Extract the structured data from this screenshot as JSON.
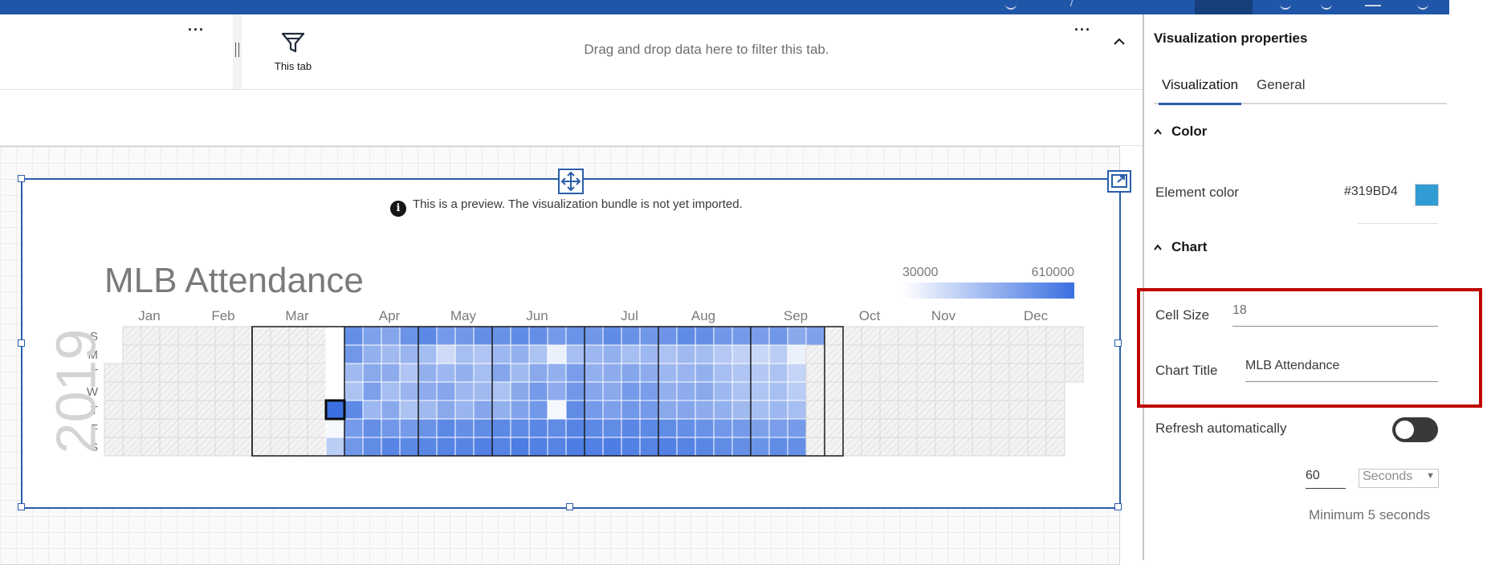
{
  "filter_bar": {
    "this_tab_label": "This tab",
    "drop_hint": "Drag and drop data here to filter this tab."
  },
  "visualization": {
    "preview_notice": "This is a preview. The visualization bundle is not yet imported.",
    "chart_title": "MLB Attendance",
    "year": "2019"
  },
  "chart_data": {
    "type": "heatmap",
    "title": "MLB Attendance",
    "year": "2019",
    "months": [
      "Jan",
      "Feb",
      "Mar",
      "Apr",
      "May",
      "Jun",
      "Jul",
      "Aug",
      "Sep",
      "Oct",
      "Nov",
      "Dec"
    ],
    "weekdays": [
      "S",
      "M",
      "T",
      "W",
      "T",
      "F",
      "S"
    ],
    "legend": {
      "min": 30000,
      "max": 610000,
      "min_label": "30000",
      "max_label": "610000"
    },
    "color_range": [
      "#ffffff",
      "#3a6fe0"
    ],
    "season_start_week": 12,
    "season_end_week": 39,
    "week_levels": [
      [],
      [],
      [],
      [],
      [],
      [],
      [],
      [],
      [],
      [],
      [],
      [],
      [
        0,
        0,
        0,
        0,
        0,
        0.05,
        0.35
      ],
      [
        0.78,
        0.72,
        0.48,
        0.42,
        0.82,
        0.7,
        0.72
      ],
      [
        0.65,
        0.55,
        0.6,
        0.66,
        0.5,
        0.78,
        0.8
      ],
      [
        0.62,
        0.48,
        0.58,
        0.45,
        0.6,
        0.72,
        0.85
      ],
      [
        0.75,
        0.52,
        0.4,
        0.52,
        0.42,
        0.7,
        0.82
      ],
      [
        0.82,
        0.46,
        0.55,
        0.58,
        0.48,
        0.76,
        0.84
      ],
      [
        0.7,
        0.25,
        0.5,
        0.62,
        0.6,
        0.82,
        0.86
      ],
      [
        0.72,
        0.45,
        0.55,
        0.5,
        0.52,
        0.78,
        0.85
      ],
      [
        0.78,
        0.4,
        0.45,
        0.48,
        0.62,
        0.8,
        0.88
      ],
      [
        0.76,
        0.5,
        0.62,
        0.42,
        0.55,
        0.82,
        0.86
      ],
      [
        0.8,
        0.55,
        0.48,
        0.6,
        0.64,
        0.8,
        0.9
      ],
      [
        0.78,
        0.42,
        0.6,
        0.7,
        0.72,
        0.84,
        0.88
      ],
      [
        0.7,
        0.1,
        0.55,
        0.58,
        0.05,
        0.8,
        0.86
      ],
      [
        0.75,
        0.45,
        0.68,
        0.72,
        0.8,
        0.86,
        0.9
      ],
      [
        0.72,
        0.5,
        0.55,
        0.62,
        0.7,
        0.82,
        0.88
      ],
      [
        0.8,
        0.55,
        0.58,
        0.6,
        0.66,
        0.8,
        0.9
      ],
      [
        0.76,
        0.45,
        0.62,
        0.7,
        0.72,
        0.84,
        0.88
      ],
      [
        0.72,
        0.5,
        0.58,
        0.68,
        0.7,
        0.82,
        0.86
      ],
      [
        0.74,
        0.42,
        0.5,
        0.55,
        0.6,
        0.8,
        0.88
      ],
      [
        0.8,
        0.48,
        0.52,
        0.58,
        0.62,
        0.78,
        0.86
      ],
      [
        0.78,
        0.46,
        0.55,
        0.6,
        0.58,
        0.76,
        0.84
      ],
      [
        0.72,
        0.38,
        0.45,
        0.5,
        0.55,
        0.72,
        0.8
      ],
      [
        0.7,
        0.32,
        0.4,
        0.42,
        0.48,
        0.7,
        0.78
      ],
      [
        0.68,
        0.28,
        0.38,
        0.4,
        0.45,
        0.66,
        0.75
      ],
      [
        0.72,
        0.35,
        0.42,
        0.44,
        0.5,
        0.68,
        0.8
      ],
      [
        0.6,
        0.1,
        0.3,
        0.35,
        0.45,
        0.7,
        0.78
      ],
      [
        0.65
      ]
    ],
    "highlighted_cell": {
      "week": 12,
      "day": 4
    }
  },
  "panel": {
    "title": "Visualization properties",
    "tabs": [
      "Visualization",
      "General"
    ],
    "color_section": "Color",
    "element_color_label": "Element color",
    "element_color_value": "#319BD4",
    "element_color": "#319BD4",
    "chart_section": "Chart",
    "cell_size_label": "Cell Size",
    "cell_size_value": "18",
    "chart_title_label": "Chart Title",
    "chart_title_value": "MLB Attendance",
    "refresh_label": "Refresh automatically",
    "interval_value": "60",
    "interval_unit": "Seconds",
    "minimum_note": "Minimum 5 seconds"
  },
  "colors": {
    "brand_bar": "#1f56a8",
    "selection_border": "#2a5ea8",
    "highlight_box": "#c00000"
  }
}
